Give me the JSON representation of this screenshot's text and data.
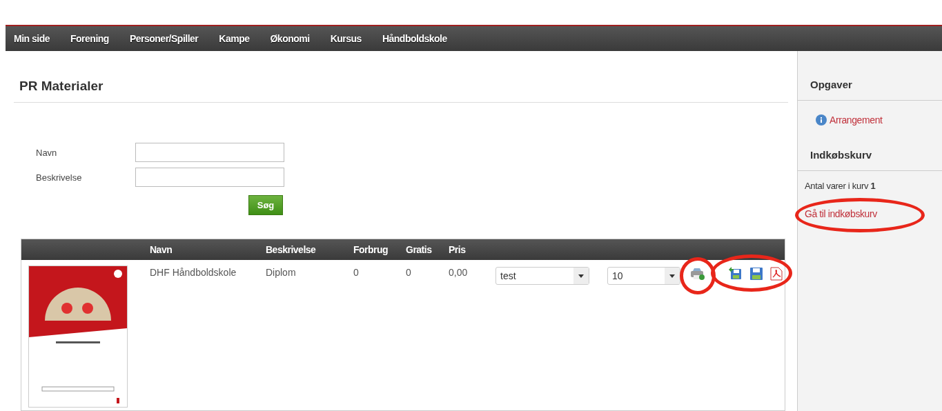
{
  "nav": {
    "items": [
      {
        "label": "Min side"
      },
      {
        "label": "Forening"
      },
      {
        "label": "Personer/Spiller"
      },
      {
        "label": "Kampe"
      },
      {
        "label": "Økonomi"
      },
      {
        "label": "Kursus"
      },
      {
        "label": "Håndboldskole"
      }
    ]
  },
  "main": {
    "title": "PR Materialer",
    "search": {
      "fields": [
        {
          "label": "Navn"
        },
        {
          "label": "Beskrivelse"
        }
      ],
      "button": "Søg"
    },
    "table": {
      "columns": [
        "Navn",
        "Beskrivelse",
        "Forbrug",
        "Gratis",
        "Pris"
      ],
      "rows": [
        {
          "cells": [
            "DHF Håndboldskole",
            "Diplom",
            "0",
            "0",
            "0,00"
          ],
          "selects": [
            {
              "value": "test"
            },
            {
              "value": "10"
            }
          ],
          "print_annotated": true,
          "exports_annotated": true
        }
      ]
    }
  },
  "sidebar": {
    "title": "Opgaver",
    "task_link": "Arrangement",
    "cart_title": "Indkøbskurv",
    "cart_count": "Antal varer i kurv **1**",
    "cart_link": "Gå til indkøbskurv",
    "cart_link_annotated": true
  }
}
